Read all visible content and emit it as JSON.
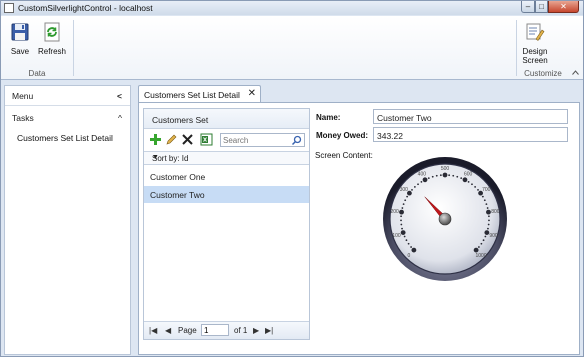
{
  "window": {
    "title": "CustomSilverlightControl - localhost",
    "controls": {
      "minimize": "–",
      "maximize": "□",
      "close": "✕"
    }
  },
  "ribbon": {
    "save_label": "Save",
    "refresh_label": "Refresh",
    "data_group": "Data",
    "design_label_1": "Design",
    "design_label_2": "Screen",
    "customize_group": "Customize",
    "collapse_icon": "chevron-up-icon"
  },
  "menu": {
    "title": "Menu",
    "collapse": "<",
    "tasks_title": "Tasks",
    "tasks_toggle": "^",
    "items": [
      {
        "label": "Customers Set List Detail"
      }
    ]
  },
  "tab": {
    "label": "Customers Set List Detail",
    "close": "✕"
  },
  "list": {
    "title": "Customers Set",
    "search_placeholder": "Search",
    "sort_label": "Sort by: Id",
    "sort_dropdown": "▼",
    "rows": [
      {
        "label": "Customer One",
        "selected": false
      },
      {
        "label": "Customer Two",
        "selected": true
      }
    ],
    "pager": {
      "first": "|◀",
      "prev": "◀",
      "page_label": "Page",
      "page_value": "1",
      "of_label": "of 1",
      "next": "▶",
      "last": "▶|"
    }
  },
  "details": {
    "name_label": "Name:",
    "name_value": "Customer Two",
    "money_label": "Money Owed:",
    "money_value": "343.22",
    "screen_content_label": "Screen Content:"
  },
  "gauge": {
    "min": 0,
    "max": 1000,
    "value": 343.22,
    "ticks": [
      "0",
      "100",
      "200",
      "300",
      "400",
      "500",
      "600",
      "700",
      "800",
      "900",
      "1000"
    ],
    "colors": {
      "needle": "#c0171b",
      "face": "#dfe2ea",
      "rim": "#4a4c63",
      "accent": "#1a1b2a"
    }
  },
  "colors": {
    "accent": "#c7dcf5",
    "chrome": "#dde6f2"
  }
}
